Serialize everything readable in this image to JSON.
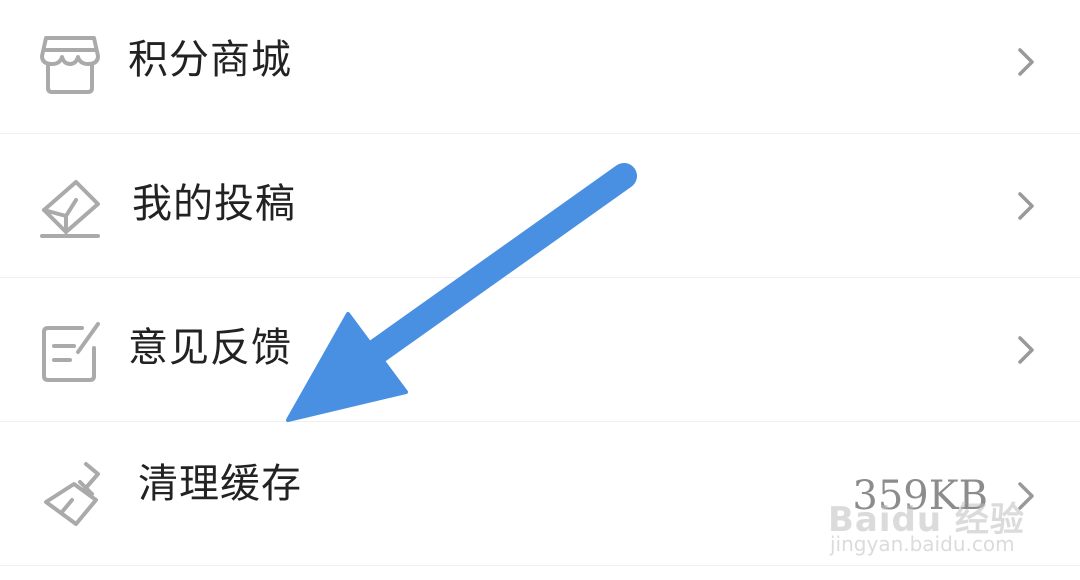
{
  "menu": {
    "items": [
      {
        "label": "积分商城",
        "icon": "store-icon",
        "value": ""
      },
      {
        "label": "我的投稿",
        "icon": "envelope-pen-icon",
        "value": ""
      },
      {
        "label": "意见反馈",
        "icon": "feedback-edit-icon",
        "value": ""
      },
      {
        "label": "清理缓存",
        "icon": "broom-icon",
        "value": "359KB"
      }
    ]
  },
  "annotation": {
    "arrow_color": "#4A90E2"
  },
  "watermark": {
    "main": "Baidu 经验",
    "sub": "jingyan.baidu.com"
  },
  "colors": {
    "icon_gray": "#aaaaaa",
    "chevron_gray": "#999999",
    "label_text": "#222222",
    "divider": "#efefef"
  }
}
